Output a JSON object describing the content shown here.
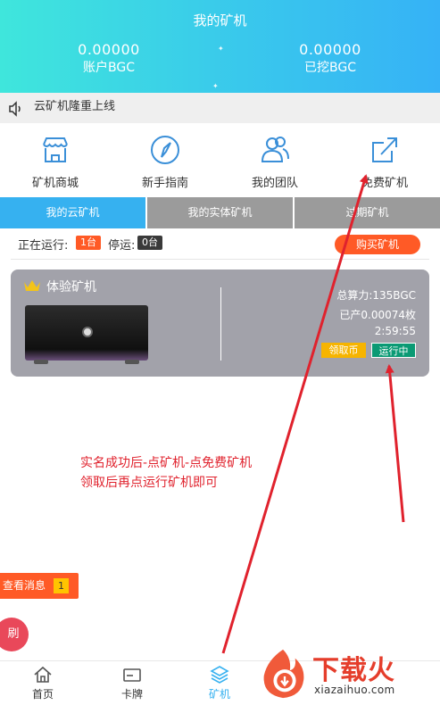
{
  "header": {
    "title": "我的矿机",
    "account": {
      "value": "0.00000",
      "label": "账户BGC"
    },
    "mined": {
      "value": "0.00000",
      "label": "已挖BGC"
    }
  },
  "notice": {
    "text": "云矿机隆重上线"
  },
  "shortcuts": [
    {
      "label": "矿机商城",
      "icon": "shop-icon"
    },
    {
      "label": "新手指南",
      "icon": "compass-icon"
    },
    {
      "label": "我的团队",
      "icon": "team-icon"
    },
    {
      "label": "免费矿机",
      "icon": "share-icon"
    }
  ],
  "tabs": [
    {
      "label": "我的云矿机",
      "active": true
    },
    {
      "label": "我的实体矿机",
      "active": false
    },
    {
      "label": "过期矿机",
      "active": false
    }
  ],
  "status": {
    "running_label": "正在运行:",
    "running_count": "1台",
    "stopped_label": "停运:",
    "stopped_count": "0台",
    "buy_button": "购买矿机"
  },
  "miner_card": {
    "name": "体验矿机",
    "hashrate": "总算力:135BGC",
    "produced": "已产0.00074枚",
    "timer": "2:59:55",
    "collect_button": "领取币",
    "status_button": "运行中"
  },
  "annotation": {
    "line1": "实名成功后-点矿机-点免费矿机",
    "line2": "领取后再点运行矿机即可"
  },
  "floating": {
    "messages_label": "查看消息",
    "messages_count": "1",
    "refresh_label": "刷"
  },
  "bottom_nav": [
    {
      "label": "首页",
      "icon": "home-icon"
    },
    {
      "label": "卡牌",
      "icon": "card-icon"
    },
    {
      "label": "矿机",
      "icon": "layers-icon",
      "active": true
    }
  ],
  "watermark": {
    "title": "下载火",
    "url": "xiazaihuo.com"
  },
  "colors": {
    "accent": "#36b1f0",
    "orange": "#ff5a26",
    "annotation": "#e0222d"
  }
}
